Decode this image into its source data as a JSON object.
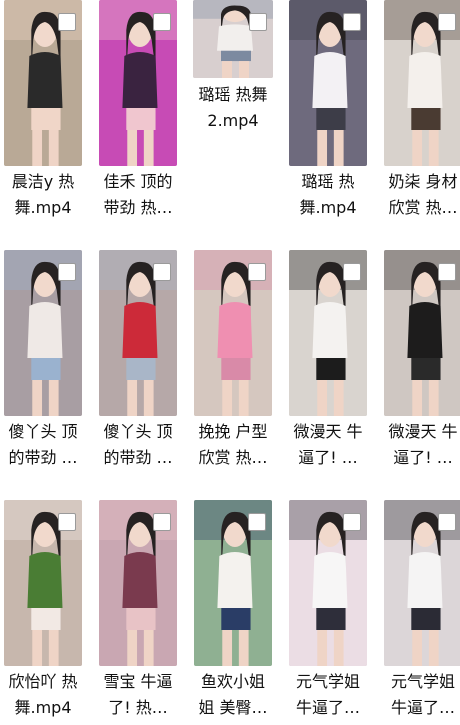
{
  "files": [
    {
      "name": "晨洁y 热舞.mp4",
      "line1": "晨洁y 热",
      "line2": "舞.mp4",
      "colors": [
        "#b9a996",
        "#2a2a2a",
        "#f0d6c8"
      ]
    },
    {
      "name": "佳禾 顶的带劲 热…",
      "line1": "佳禾 顶的",
      "line2": "带劲 热…",
      "colors": [
        "#c74bb5",
        "#3a2340",
        "#f0c6cf"
      ]
    },
    {
      "name": "璐瑶 热舞2.mp4",
      "line1": "璐瑶 热舞",
      "line2": "2.mp4",
      "colors": [
        "#d8cfcf",
        "#f2efed",
        "#7c8aa0"
      ]
    },
    {
      "name": "璐瑶 热舞.mp4",
      "line1": "璐瑶 热",
      "line2": "舞.mp4",
      "colors": [
        "#6e6a7d",
        "#f3f1f4",
        "#3d3d48"
      ]
    },
    {
      "name": "奶柒 身材欣赏 热…",
      "line1": "奶柒 身材",
      "line2": "欣赏 热…",
      "colors": [
        "#d8d2cc",
        "#f4f0ec",
        "#4a3b32"
      ]
    },
    {
      "name": "傻丫头 顶的带劲 …",
      "line1": "傻丫头 顶",
      "line2": "的带劲 …",
      "colors": [
        "#a89ea3",
        "#efe9e6",
        "#9ab2cf"
      ]
    },
    {
      "name": "傻丫头 顶的带劲 …",
      "line1": "傻丫头 顶",
      "line2": "的带劲 …",
      "colors": [
        "#b6a8a8",
        "#cc2a39",
        "#a9b6c8"
      ]
    },
    {
      "name": "挽挽 户型欣赏 热…",
      "line1": "挽挽 户型",
      "line2": "欣赏 热…",
      "colors": [
        "#d5c7bf",
        "#ef8fb1",
        "#d98aa8"
      ]
    },
    {
      "name": "微漫天 牛逼了! …",
      "line1": "微漫天 牛",
      "line2": "逼了! …",
      "colors": [
        "#d9d4cf",
        "#f4f2f0",
        "#1c1c1c"
      ]
    },
    {
      "name": "微漫天 牛逼了! …",
      "line1": "微漫天 牛",
      "line2": "逼了! …",
      "colors": [
        "#cfc7c2",
        "#1d1c1c",
        "#2a2a2a"
      ]
    },
    {
      "name": "欣怡吖 热舞.mp4",
      "line1": "欣怡吖 热",
      "line2": "舞.mp4",
      "colors": [
        "#c7b7ad",
        "#4a7d34",
        "#f2e9e4"
      ]
    },
    {
      "name": "雪宝 牛逼了! 热…",
      "line1": "雪宝 牛逼",
      "line2": "了! 热…",
      "colors": [
        "#c9a7b2",
        "#7a3a4e",
        "#e8c3c6"
      ]
    },
    {
      "name": "鱼欢小姐姐 美臀…",
      "line1": "鱼欢小姐",
      "line2": "姐 美臀…",
      "colors": [
        "#8fb092",
        "#f4f2ee",
        "#2a3d66"
      ]
    },
    {
      "name": "元气学姐 牛逼了…",
      "line1": "元气学姐",
      "line2": "牛逼了…",
      "colors": [
        "#ebdde4",
        "#f7f6f6",
        "#2e2e3a"
      ]
    },
    {
      "name": "元气学姐 牛逼了…",
      "line1": "元气学姐",
      "line2": "牛逼了…",
      "colors": [
        "#dcd6d8",
        "#f5f4f4",
        "#2b2b35"
      ]
    }
  ]
}
